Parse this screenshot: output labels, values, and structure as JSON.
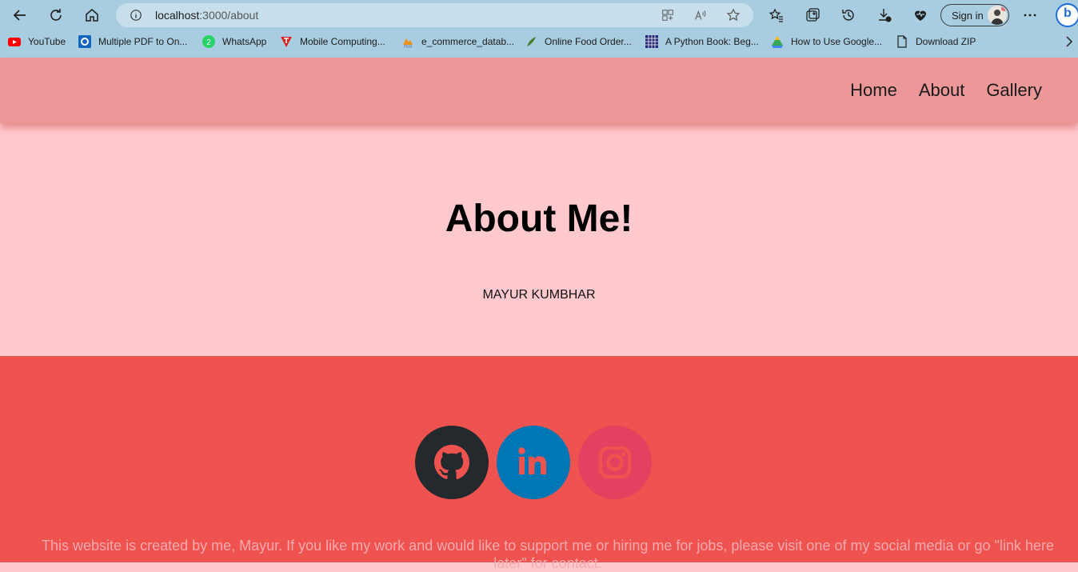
{
  "browser": {
    "url_host": "localhost",
    "url_path": ":3000/about",
    "sign_in_label": "Sign in",
    "bookmarks": [
      {
        "label": "YouTube",
        "icon": "youtube-icon"
      },
      {
        "label": "Multiple PDF to On...",
        "icon": "pdf-icon"
      },
      {
        "label": "WhatsApp",
        "icon": "whatsapp-icon"
      },
      {
        "label": "Mobile Computing...",
        "icon": "t-logo-icon"
      },
      {
        "label": "e_commerce_datab...",
        "icon": "phpmyadmin-icon"
      },
      {
        "label": "Online Food Order...",
        "icon": "leaf-icon"
      },
      {
        "label": "A Python Book: Beg...",
        "icon": "grid-icon"
      },
      {
        "label": "How to Use Google...",
        "icon": "google-drive-icon"
      },
      {
        "label": "Download ZIP",
        "icon": "file-icon"
      }
    ]
  },
  "header": {
    "nav": [
      {
        "label": "Home"
      },
      {
        "label": "About"
      },
      {
        "label": "Gallery"
      }
    ]
  },
  "main": {
    "title": "About Me!",
    "name": "MAYUR KUMBHAR"
  },
  "footer": {
    "socials": [
      {
        "name": "github",
        "color": "#24292e",
        "icon_color": "#ee5350"
      },
      {
        "name": "linkedin",
        "color": "#0077b5",
        "icon_color": "#ee5350"
      },
      {
        "name": "instagram",
        "color": "#e4405f",
        "icon_color": "#ee5350"
      }
    ],
    "text": "This website is created by me, Mayur. If you like my work and would like to support me or hiring me for jobs, please visit one of my social media or go \"link here later\" for contact."
  },
  "colors": {
    "header_bg": "#ec9798",
    "main_bg": "#ffc9ce",
    "footer_bg": "#ee5350",
    "footer_text": "#f7a9ad"
  }
}
